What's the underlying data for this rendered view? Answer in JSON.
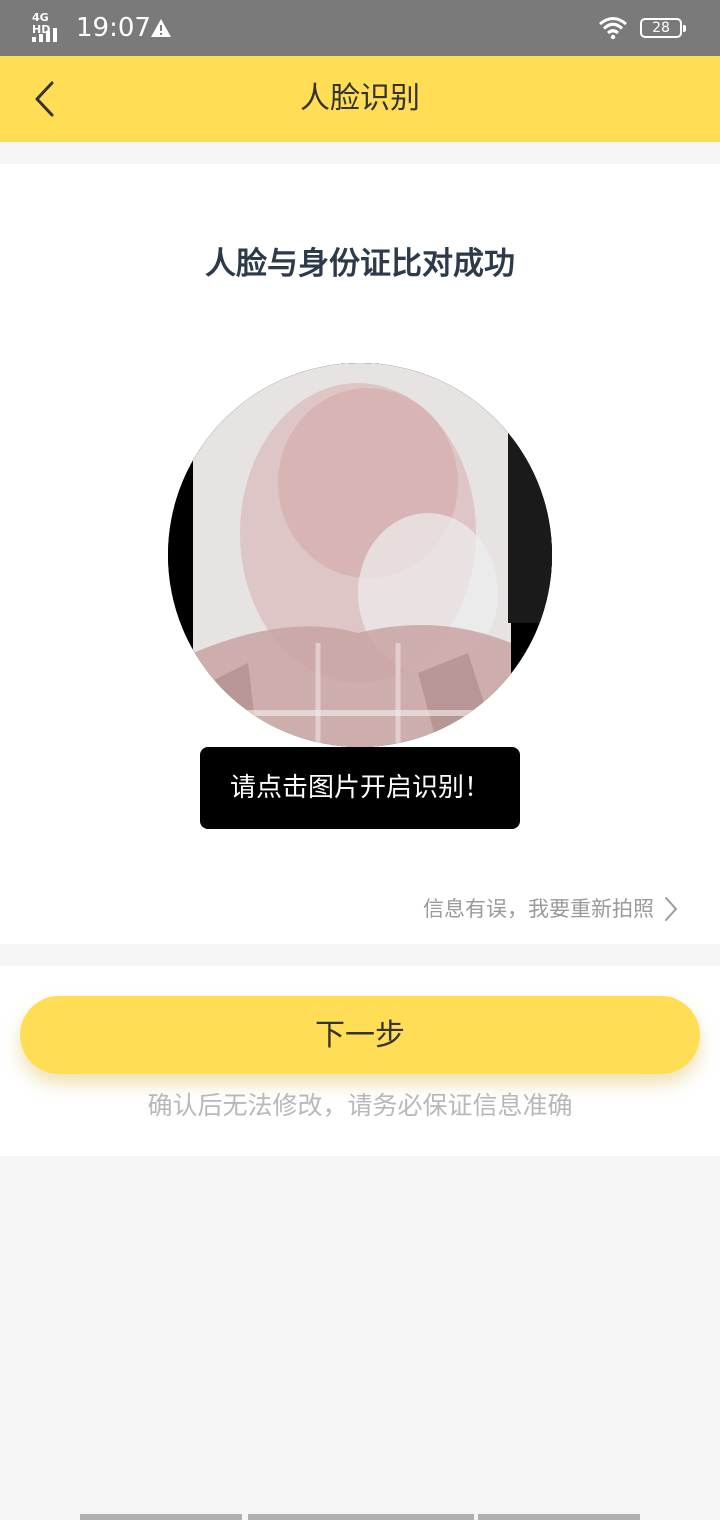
{
  "status_bar": {
    "network": "4G HD",
    "time": "19:07",
    "battery": "28",
    "icons": [
      "signal-icon",
      "warning-icon",
      "wifi-icon",
      "battery-icon"
    ]
  },
  "header": {
    "title": "人脸识别",
    "back_icon": "chevron-left-icon",
    "background_color": "#ffdd55"
  },
  "main": {
    "result_title": "人脸与身份证比对成功",
    "toast": "请点击图片开启识别！",
    "retake_link": "信息有误，我要重新拍照",
    "retake_icon": "chevron-right-icon"
  },
  "footer": {
    "next_button": "下一步",
    "hint": "确认后无法修改，请务必保证信息准确"
  },
  "colors": {
    "accent": "#ffdd55",
    "title": "#2c3a4a",
    "muted": "#9a9a9a"
  }
}
